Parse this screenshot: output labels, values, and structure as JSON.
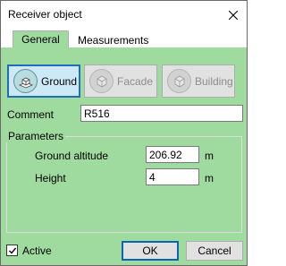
{
  "window": {
    "title": "Receiver object"
  },
  "tabs": [
    {
      "label": "General",
      "active": true
    },
    {
      "label": "Measurements",
      "active": false
    }
  ],
  "modes": [
    {
      "label": "Ground",
      "icon": "ground-icon",
      "selected": true,
      "enabled": true
    },
    {
      "label": "Facade",
      "icon": "facade-icon",
      "selected": false,
      "enabled": false
    },
    {
      "label": "Building",
      "icon": "building-icon",
      "selected": false,
      "enabled": false
    }
  ],
  "comment": {
    "label": "Comment",
    "value": "R516"
  },
  "parameters": {
    "title": "Parameters",
    "ground_altitude": {
      "label": "Ground altitude",
      "value": "206.92",
      "unit": "m"
    },
    "height": {
      "label": "Height",
      "value": "4",
      "unit": "m"
    }
  },
  "active": {
    "label": "Active",
    "checked": true
  },
  "buttons": {
    "ok": "OK",
    "cancel": "Cancel"
  },
  "colors": {
    "background": "#9fda9f",
    "selected_border": "#1e6fb8",
    "selected_fill": "#cde8f7"
  }
}
